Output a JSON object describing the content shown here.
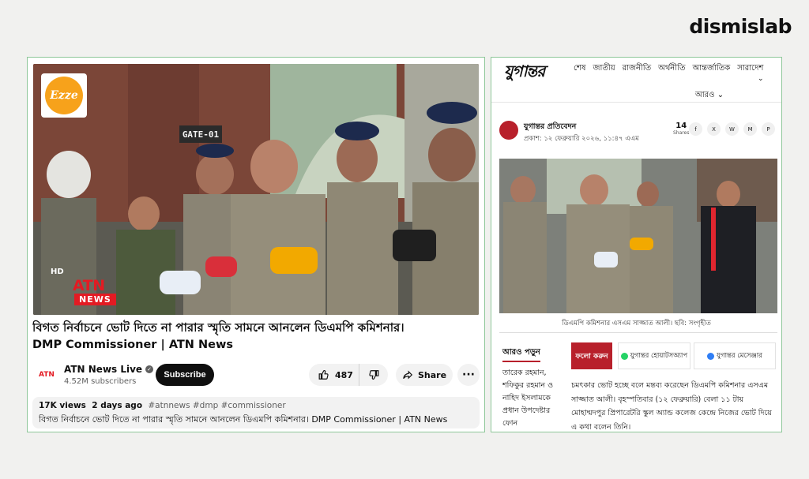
{
  "brand": {
    "name": "dismislab"
  },
  "youtube": {
    "thumbnail_badge": "Ezze",
    "gate_sign": "GATE-01",
    "channel_logo": {
      "hd": "HD",
      "name": "ATN",
      "tag": "NEWS"
    },
    "title_bn": "বিগত নির্বাচনে ভোট দিতে না পারার স্মৃতি সামনে আনলেন ডিএমপি কমিশনার।",
    "title_en": "DMP Commissioner | ATN News",
    "channel": {
      "name": "ATN News Live",
      "subscribers": "4.52M subscribers",
      "avatar_text": "ATN"
    },
    "subscribe_label": "Subscribe",
    "likes": "487",
    "share_label": "Share",
    "more_label": "···",
    "views": "17K views",
    "posted": "2 days ago",
    "hashtags": "#atnnews #dmp #commissioner",
    "description": "বিগত নির্বাচনে ভোট দিতে না পারার স্মৃতি সামনে আনলেন ডিএমপি কমিশনার। DMP Commissioner | ATN News"
  },
  "jugantor": {
    "logo": "যুগান্তর",
    "nav": [
      "শেষ",
      "জাতীয়",
      "রাজনীতি",
      "অর্থনীতি",
      "আন্তর্জাতিক",
      "সারাদেশ"
    ],
    "more_label": "আরও",
    "reporter": "যুগান্তর প্রতিবেদন",
    "published": "প্রকাশ: ১২ ফেব্রুয়ারি ২০২৬, ১১:৪৭ এএম",
    "shares_count": "14",
    "shares_label": "Shares",
    "share_icons": [
      "f",
      "X",
      "W",
      "M",
      "P"
    ],
    "caption": "ডিএমপি কমিশনার এসএম সাজ্জাত আলী। ছবি: সংগৃহীত",
    "read_more_label": "আরও পড়ুন",
    "read_more_item": "তারেক রহমান, শফিকুর রহমান ও নাহিদ ইসলামকে প্রধান উপদেষ্টার ফোন",
    "follow_label": "ফলো করুন",
    "whatsapp_label": "যুগান্তর হোয়াটসঅ্যাপ",
    "messenger_label": "যুগান্তর মেসেঞ্জার",
    "body": "চমৎকার ভোট হচ্ছে বলে মন্তব্য করেছেন ডিএমপি কমিশনার এসএম সাজ্জাত আলী। বৃহস্পতিবার (১২ ফেব্রুয়ারি) বেলা ১১ টায় মোহাম্মদপুর প্রিপারেটরি স্কুল অ্যান্ড কলেজ কেন্দ্রে নিজের ভোট দিয়ে এ কথা বলেন তিনি।"
  }
}
